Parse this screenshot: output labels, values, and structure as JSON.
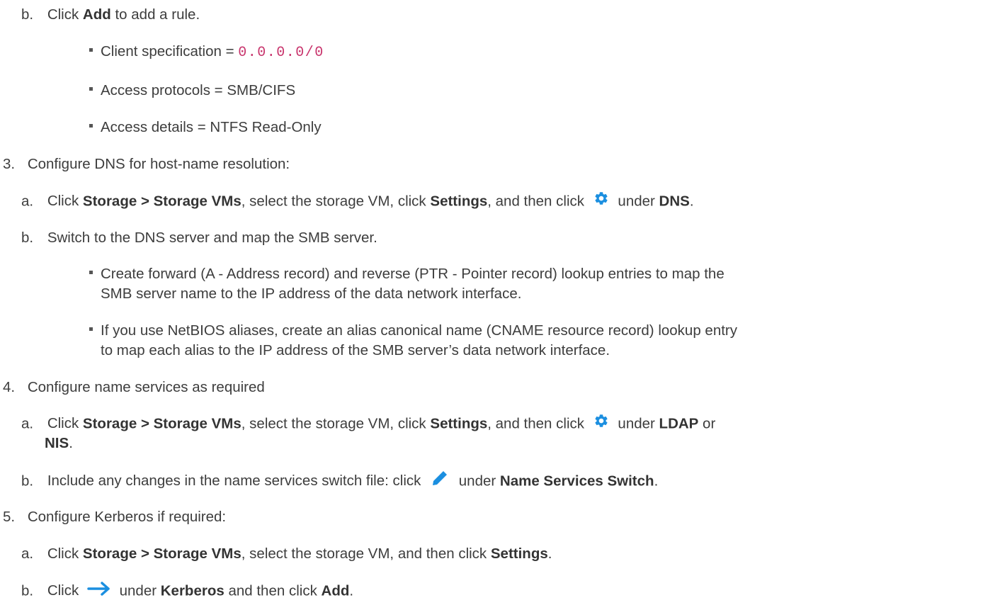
{
  "step2": {
    "b": {
      "marker": "b.",
      "t1": "Click ",
      "b1": "Add",
      "t2": " to add a rule."
    },
    "bullets": [
      {
        "text": "Client specification = ",
        "code": "0.0.0.0/0"
      },
      {
        "text": "Access protocols = SMB/CIFS"
      },
      {
        "text": "Access details = NTFS Read-Only"
      }
    ]
  },
  "step3": {
    "marker": "3.",
    "title": "Configure DNS for host-name resolution:",
    "a": {
      "marker": "a.",
      "t1": "Click ",
      "b1": "Storage > Storage VMs",
      "t2": ", select the storage VM, click ",
      "b2": "Settings",
      "t3": ", and then click ",
      "t4": " under ",
      "b3": "DNS",
      "t5": "."
    },
    "b": {
      "marker": "b.",
      "text": "Switch to the DNS server and map the SMB server."
    },
    "bullets": [
      {
        "l1": "Create forward (A - Address record) and reverse (PTR - Pointer record) lookup entries to map the",
        "l2": "SMB server name to the IP address of the data network interface."
      },
      {
        "l1": "If you use NetBIOS aliases, create an alias canonical name (CNAME resource record) lookup entry",
        "l2": "to map each alias to the IP address of the SMB server’s data network interface."
      }
    ]
  },
  "step4": {
    "marker": "4.",
    "title": "Configure name services as required",
    "a": {
      "marker": "a.",
      "t1": "Click ",
      "b1": "Storage > Storage VMs",
      "t2": ", select the storage VM, click ",
      "b2": "Settings",
      "t3": ", and then click ",
      "t4": " under ",
      "b3": "LDAP",
      "t5": " or",
      "b4": "NIS",
      "t6": "."
    },
    "b": {
      "marker": "b.",
      "t1": "Include any changes in the name services switch file: click ",
      "t2": " under ",
      "b1": "Name Services Switch",
      "t3": "."
    }
  },
  "step5": {
    "marker": "5.",
    "title": "Configure Kerberos if required:",
    "a": {
      "marker": "a.",
      "t1": "Click ",
      "b1": "Storage > Storage VMs",
      "t2": ", select the storage VM, and then click ",
      "b2": "Settings",
      "t3": "."
    },
    "b": {
      "marker": "b.",
      "t1": "Click ",
      "t2": " under ",
      "b1": "Kerberos",
      "t3": " and then click ",
      "b2": "Add",
      "t4": "."
    }
  },
  "icons": {
    "gear": "gear-icon",
    "pencil": "pencil-icon",
    "arrow": "arrow-right-icon"
  },
  "colors": {
    "text": "#3d3d3d",
    "code": "#c8346c",
    "icon": "#1b8fe0"
  }
}
